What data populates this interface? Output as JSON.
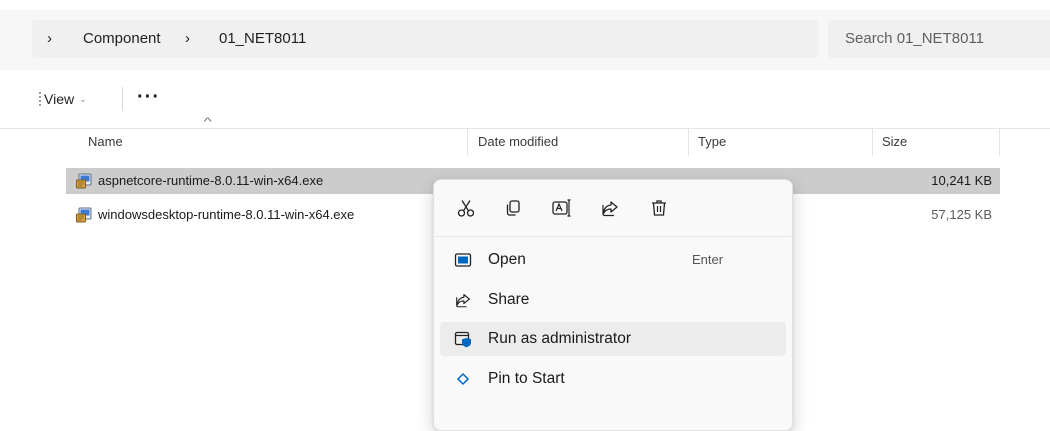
{
  "breadcrumb": {
    "chevron": "›",
    "items": [
      "Component",
      "01_NET8011"
    ]
  },
  "search": {
    "placeholder": "Search 01_NET8011"
  },
  "toolbar": {
    "view_label": "View",
    "view_chevron": "⌄",
    "more_label": "···"
  },
  "columns": {
    "name": "Name",
    "date_modified": "Date modified",
    "type": "Type",
    "size": "Size"
  },
  "files": [
    {
      "name": "aspnetcore-runtime-8.0.11-win-x64.exe",
      "size": "10,241 KB",
      "selected": true
    },
    {
      "name": "windowsdesktop-runtime-8.0.11-win-x64.exe",
      "size": "57,125 KB",
      "selected": false
    }
  ],
  "context_menu": {
    "quick_actions": [
      "cut-icon",
      "copy-icon",
      "rename-icon",
      "share-icon",
      "delete-icon"
    ],
    "items": [
      {
        "label": "Open",
        "shortcut": "Enter",
        "icon": "open-icon"
      },
      {
        "label": "Share",
        "shortcut": "",
        "icon": "share-icon"
      },
      {
        "label": "Run as administrator",
        "shortcut": "",
        "icon": "shield-icon",
        "hovered": true
      },
      {
        "label": "Pin to Start",
        "shortcut": "",
        "icon": "pin-icon"
      }
    ]
  },
  "colors": {
    "selection": "#cccccc",
    "accent": "#0067c0",
    "menu_bg": "#f9f9f9"
  }
}
